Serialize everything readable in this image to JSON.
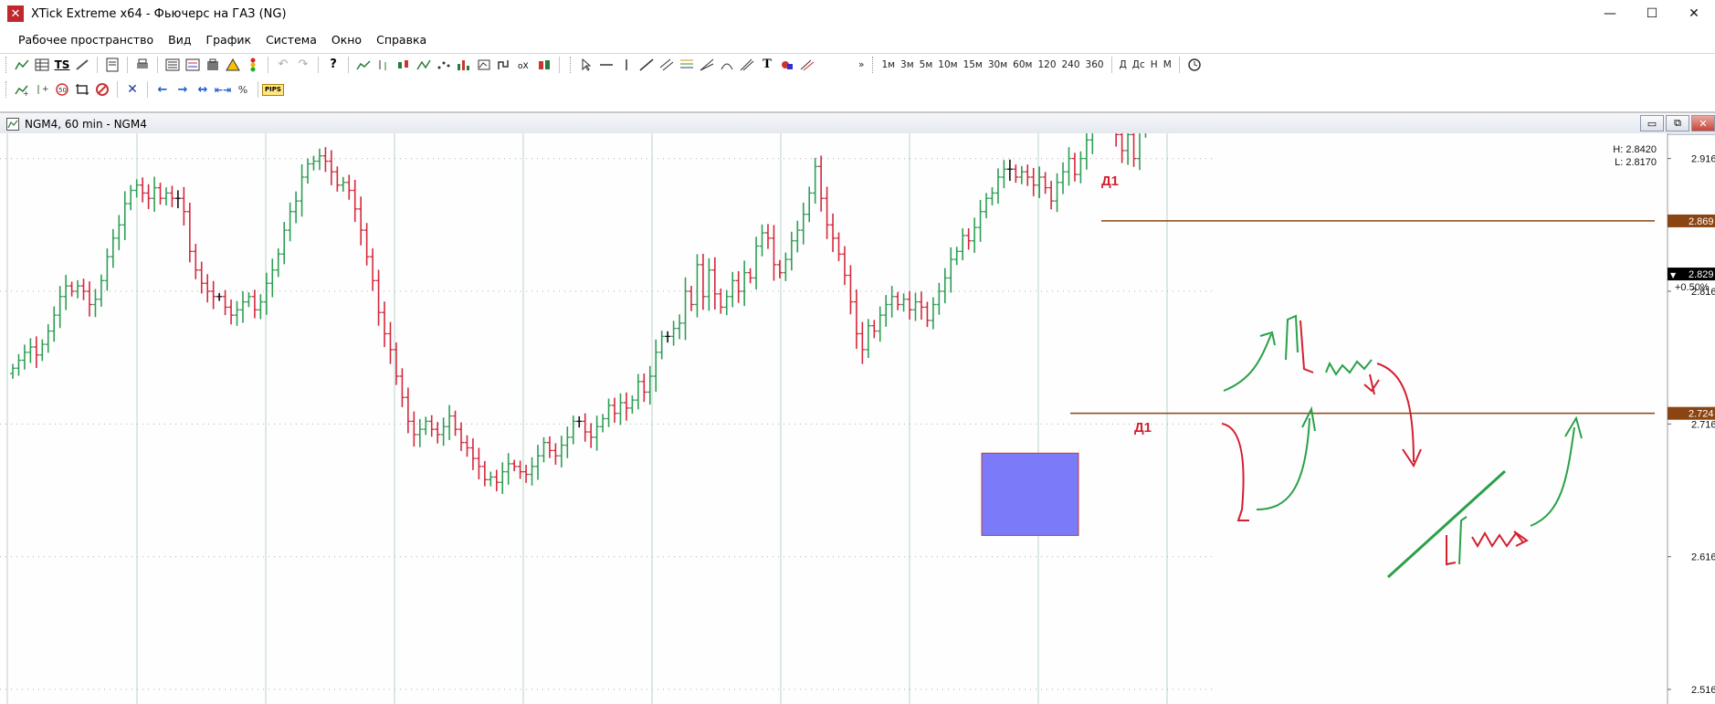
{
  "window": {
    "title": "XTick Extreme x64 - Фьючерс на ГАЗ (NG)",
    "icon": "x-logo-icon",
    "controls": [
      "minimize",
      "maximize",
      "close"
    ]
  },
  "menu": [
    "Рабочее пространство",
    "Вид",
    "График",
    "Система",
    "Окно",
    "Справка"
  ],
  "toolbar1": {
    "timeframes": [
      "1м",
      "3м",
      "5м",
      "10м",
      "15м",
      "30м",
      "60м",
      "120",
      "240",
      "360"
    ],
    "periods": [
      "Д",
      "Дс",
      "Н",
      "М"
    ]
  },
  "toolbar2": {
    "pips_label": "PIPS"
  },
  "chart": {
    "title": "NGM4, 60 min - NGM4",
    "high_label": "H: 2.8420",
    "low_label": "L: 2.8170",
    "last_change": "+0.50%",
    "colors": {
      "up": "#2e9e55",
      "down": "#d4283c",
      "level_line": "#8b4513",
      "box": "#7b7bfa",
      "annot_green": "#2aa048",
      "annot_red": "#d41f2e"
    },
    "annotations": [
      "Д1",
      "Д1"
    ]
  },
  "chart_data": {
    "type": "ohlc",
    "price_axis_ticks": [
      "2.916",
      "2.816",
      "2.716",
      "2.616",
      "2.516"
    ],
    "price_tags": [
      {
        "label": "2.869",
        "value": 2.869,
        "style": "level"
      },
      {
        "label": "2.829",
        "value": 2.829,
        "style": "last"
      },
      {
        "label": "2.724",
        "value": 2.724,
        "style": "level"
      }
    ],
    "ylim": [
      2.505,
      2.935
    ],
    "horizontal_levels": [
      2.869,
      2.724
    ],
    "bars_first_close": 2.754,
    "bar_moves": [
      0.004,
      0.006,
      0.006,
      0.004,
      -0.006,
      0.008,
      0.01,
      0.012,
      0.014,
      0.008,
      -0.004,
      0.004,
      -0.004,
      -0.01,
      0.004,
      0.014,
      0.018,
      0.014,
      0.01,
      0.016,
      0.01,
      0.004,
      -0.006,
      -0.004,
      0.008,
      -0.008,
      0.004,
      -0.004,
      0.0,
      -0.01,
      -0.03,
      -0.014,
      -0.01,
      -0.006,
      -0.004,
      0.0,
      -0.008,
      -0.006,
      0.004,
      0.006,
      0.004,
      -0.01,
      0.006,
      0.014,
      0.01,
      0.012,
      0.018,
      0.014,
      0.008,
      0.018,
      0.01,
      0.002,
      0.004,
      -0.004,
      -0.008,
      -0.01,
      0.002,
      -0.006,
      -0.014,
      -0.016,
      -0.02,
      -0.018,
      -0.024,
      -0.016,
      -0.012,
      -0.02,
      -0.016,
      -0.018,
      -0.01,
      0.004,
      0.006,
      -0.006,
      -0.004,
      0.006,
      0.008,
      -0.01,
      -0.01,
      -0.004,
      -0.008,
      -0.006,
      -0.01,
      0.002,
      -0.004,
      0.008,
      0.006,
      -0.002,
      -0.004,
      -0.002,
      0.006,
      0.008,
      0.01,
      -0.006,
      -0.004,
      0.008,
      0.006,
      0.012,
      0.0,
      -0.008,
      -0.004,
      0.008,
      0.006,
      0.01,
      -0.006,
      0.008,
      -0.004,
      0.006,
      0.014,
      -0.008,
      0.012,
      0.018,
      0.012,
      0.0,
      0.006,
      0.004,
      0.024,
      -0.01,
      0.03,
      -0.024,
      0.02,
      -0.018,
      -0.01,
      0.008,
      0.012,
      -0.008,
      0.014,
      -0.004,
      0.024,
      0.01,
      -0.004,
      -0.02,
      -0.006,
      0.01,
      0.014,
      0.008,
      0.012,
      0.016,
      0.02,
      -0.024,
      -0.02,
      -0.01,
      -0.012,
      -0.016,
      -0.02,
      -0.024,
      -0.012,
      0.018,
      -0.004,
      0.012,
      0.008,
      0.006,
      -0.006,
      0.004,
      -0.008,
      0.006,
      -0.004,
      -0.01,
      0.012,
      0.01,
      0.01,
      0.014,
      0.006,
      0.012,
      -0.004,
      0.01,
      0.012,
      0.01,
      0.004,
      0.012,
      0.006,
      0.0,
      -0.006,
      0.004,
      -0.004,
      -0.006,
      0.006,
      -0.008,
      -0.01,
      0.014,
      0.008,
      0.01,
      -0.012,
      0.012,
      0.014,
      0.02,
      0.016,
      0.01,
      -0.024,
      -0.018,
      -0.012,
      0.012,
      -0.018,
      0.024,
      0.014,
      0.01,
      0.012,
      -0.002,
      -0.004,
      0.01,
      0.004,
      0.002,
      -0.004,
      -0.006,
      0.0,
      0.004
    ]
  }
}
